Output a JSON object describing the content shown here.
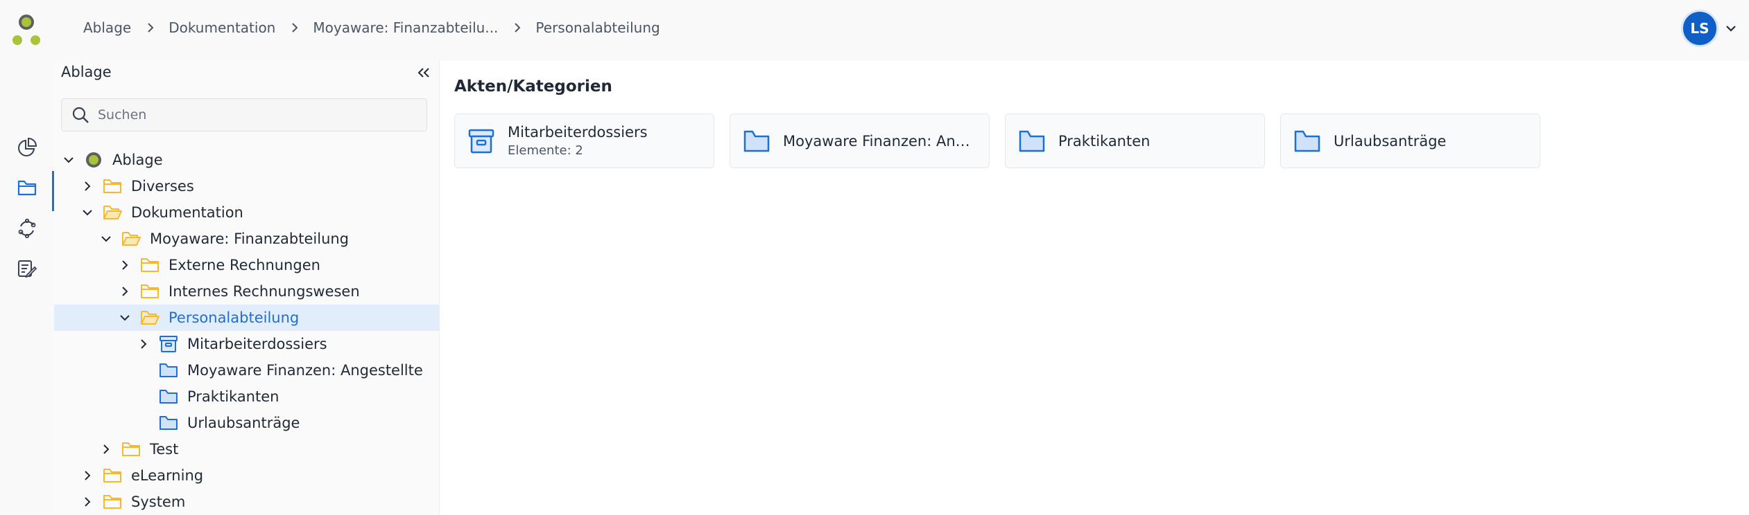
{
  "breadcrumb": [
    {
      "label": "Ablage"
    },
    {
      "label": "Dokumentation"
    },
    {
      "label": "Moyaware: Finanzabteilu..."
    },
    {
      "label": "Personalabteilung"
    }
  ],
  "user": {
    "initials": "LS"
  },
  "colors": {
    "accent": "#1d6fd8",
    "folder": "#f5b82e",
    "logo_ring": "#5f5f5f",
    "logo_dot": "#a8c43a"
  },
  "rail": {
    "items": [
      {
        "icon": "pie-chart-icon"
      },
      {
        "icon": "folder-icon",
        "active": true
      },
      {
        "icon": "sync-icon"
      },
      {
        "icon": "task-list-icon"
      }
    ]
  },
  "sidebar": {
    "title": "Ablage",
    "search_placeholder": "Suchen",
    "tree": [
      {
        "label": "Ablage",
        "level": 0,
        "expanded": true,
        "icon": "root"
      },
      {
        "label": "Diverses",
        "level": 1,
        "expanded": false,
        "icon": "folder"
      },
      {
        "label": "Dokumentation",
        "level": 1,
        "expanded": true,
        "icon": "folder-open"
      },
      {
        "label": "Moyaware: Finanzabteilung",
        "level": 2,
        "expanded": true,
        "icon": "folder-open"
      },
      {
        "label": "Externe Rechnungen",
        "level": 3,
        "expanded": false,
        "icon": "folder"
      },
      {
        "label": "Internes Rechnungswesen",
        "level": 3,
        "expanded": false,
        "icon": "folder"
      },
      {
        "label": "Personalabteilung",
        "level": 3,
        "expanded": true,
        "icon": "folder-open",
        "selected": true
      },
      {
        "label": "Mitarbeiterdossiers",
        "level": 4,
        "expanded": false,
        "icon": "archive"
      },
      {
        "label": "Moyaware Finanzen: Angestellte",
        "level": 4,
        "icon": "category"
      },
      {
        "label": "Praktikanten",
        "level": 4,
        "icon": "category"
      },
      {
        "label": "Urlaubsanträge",
        "level": 4,
        "icon": "category"
      },
      {
        "label": "Test",
        "level": 2,
        "expanded": false,
        "icon": "folder"
      },
      {
        "label": "eLearning",
        "level": 1,
        "expanded": false,
        "icon": "folder"
      },
      {
        "label": "System",
        "level": 1,
        "expanded": false,
        "icon": "folder"
      }
    ]
  },
  "main": {
    "title": "Akten/Kategorien",
    "cards": [
      {
        "title": "Mitarbeiterdossiers",
        "subtitle": "Elemente: 2",
        "icon": "archive"
      },
      {
        "title": "Moyaware Finanzen: Anges...",
        "icon": "category"
      },
      {
        "title": "Praktikanten",
        "icon": "category"
      },
      {
        "title": "Urlaubsanträge",
        "icon": "category"
      }
    ]
  }
}
